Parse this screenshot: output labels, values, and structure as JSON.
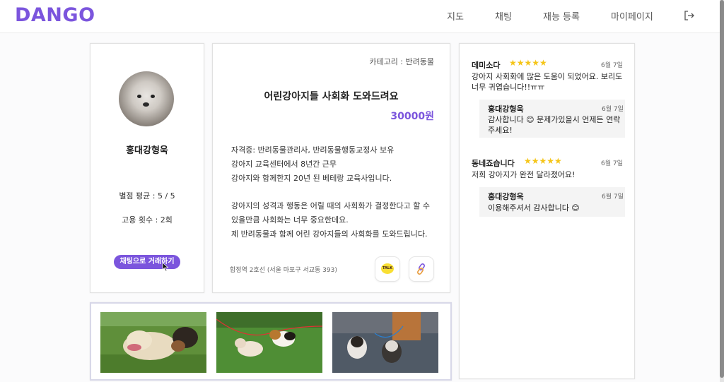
{
  "header": {
    "logo": "DANGO",
    "nav": [
      "지도",
      "채팅",
      "재능 등록",
      "마이페이지"
    ],
    "logout_icon": "logout-icon"
  },
  "profile": {
    "name": "홍대강형욱",
    "rating": "별점 평균 : 5 / 5",
    "hires": "고용 횟수 : 2회",
    "chat_button": "채팅으로 거래하기"
  },
  "post": {
    "category": "카테고리 : 반려동물",
    "title": "어린강아지들 사회화 도와드려요",
    "price": "30000원",
    "desc_lines": [
      "자격증:  반려동물관리사, 반려동물행동교정사 보유",
      "강아지 교육센터에서 8년간 근무",
      "강아지와 함께한지 20년 된 베테랑 교육사입니다.",
      "강아지의 성격과 행동은 어릴 때의 사회화가 결정한다고 할 수",
      "있을만큼 사회화는 너무 중요한데요.",
      "제 반려동물과 함께 어린 강아지들의 사회화를 도와드립니다."
    ],
    "address": "합정역 2호선 (서울 마포구 서교동 393)",
    "kakao_label": "TALK",
    "kakao_icon": "kakao-talk-icon",
    "link_icon": "link-icon"
  },
  "reviews": [
    {
      "name": "데미소다",
      "stars": "★★★★★",
      "date": "6월 7일",
      "text": [
        "강아지 사회화에 많은 도움이 되었어요. 보리도",
        "너무 귀엽습니다!!ㅠㅠ"
      ],
      "reply": {
        "name": "홍대강형욱",
        "date": "6월 7일",
        "text": [
          "감사합니다 😊 문제가있을시 언제든 연락",
          "주세요!"
        ]
      }
    },
    {
      "name": "동네죠습니다",
      "stars": "★★★★★",
      "date": "6월 7일",
      "text": [
        "저희 강아지가 완전 달라졌어요!"
      ],
      "reply": {
        "name": "홍대강형욱",
        "date": "6월 7일",
        "text": [
          "이용해주셔서 감사합니다 😊"
        ]
      }
    }
  ],
  "colors": {
    "accent": "#7b55dd",
    "kakao": "#f9df33",
    "star": "#f5c518"
  }
}
